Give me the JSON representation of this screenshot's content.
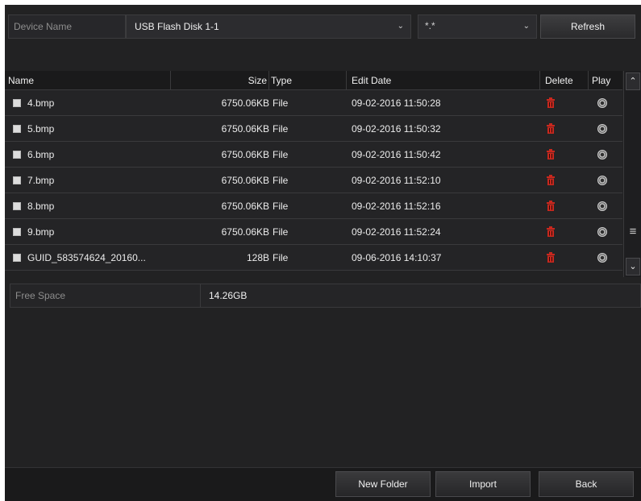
{
  "device": {
    "label": "Device Name",
    "selected": "USB Flash Disk 1-1",
    "filter_value": "*.*",
    "refresh_label": "Refresh"
  },
  "table": {
    "columns": {
      "name": "Name",
      "size": "Size",
      "type": "Type",
      "date": "Edit Date",
      "delete": "Delete",
      "play": "Play"
    },
    "rows": [
      {
        "name": "4.bmp",
        "size": "6750.06KB",
        "type": "File",
        "date": "09-02-2016 11:50:28"
      },
      {
        "name": "5.bmp",
        "size": "6750.06KB",
        "type": "File",
        "date": "09-02-2016 11:50:32"
      },
      {
        "name": "6.bmp",
        "size": "6750.06KB",
        "type": "File",
        "date": "09-02-2016 11:50:42"
      },
      {
        "name": "7.bmp",
        "size": "6750.06KB",
        "type": "File",
        "date": "09-02-2016 11:52:10"
      },
      {
        "name": "8.bmp",
        "size": "6750.06KB",
        "type": "File",
        "date": "09-02-2016 11:52:16"
      },
      {
        "name": "9.bmp",
        "size": "6750.06KB",
        "type": "File",
        "date": "09-02-2016 11:52:24"
      },
      {
        "name": "GUID_583574624_20160...",
        "size": "128B",
        "type": "File",
        "date": "09-06-2016 14:10:37"
      }
    ]
  },
  "free_space": {
    "label": "Free Space",
    "value": "14.26GB"
  },
  "footer": {
    "new_folder_label": "New Folder",
    "import_label": "Import",
    "back_label": "Back"
  },
  "colors": {
    "background": "#222223",
    "delete_icon": "#c8281e",
    "text": "#e6e6e6"
  },
  "icons": {
    "delete": "trash-icon",
    "play": "play-icon",
    "checkbox": "checkbox-icon",
    "scroll_up": "chevron-up-icon",
    "scroll_down": "chevron-down-icon",
    "scroll_thumb": "menu-icon"
  }
}
